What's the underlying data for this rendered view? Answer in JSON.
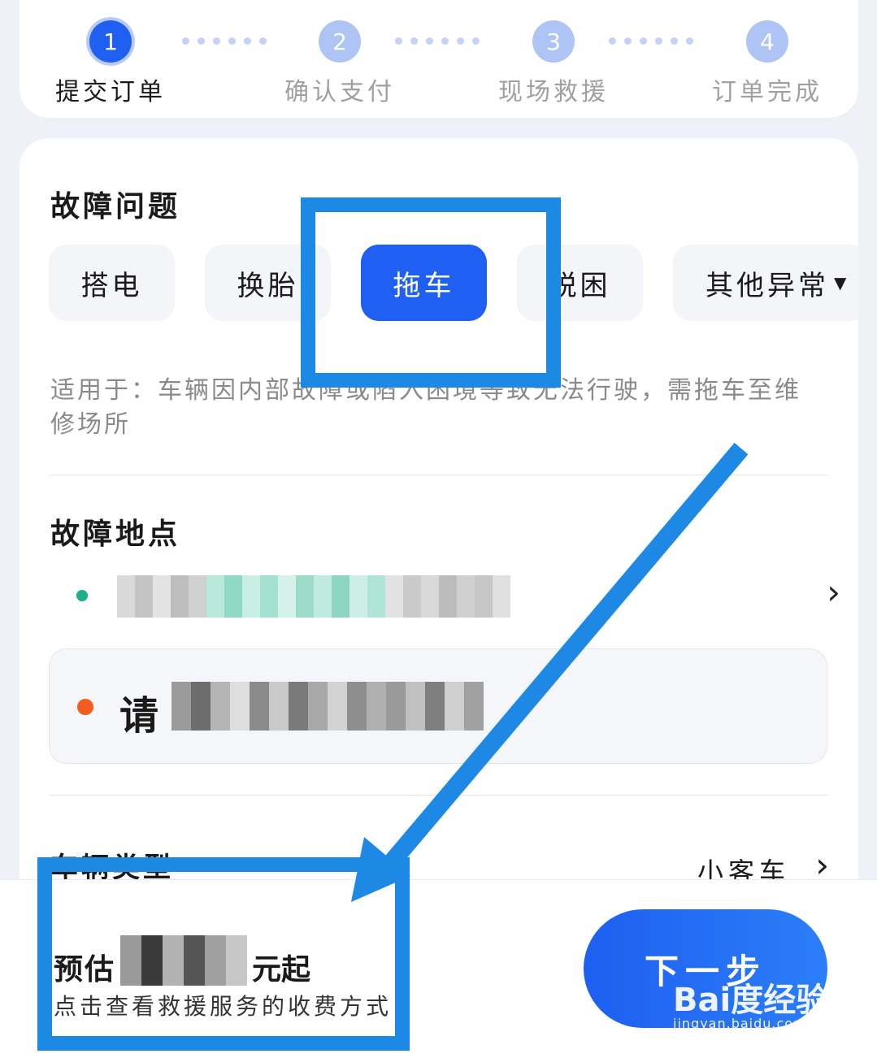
{
  "stepper": {
    "steps": [
      {
        "number": "1",
        "label": "提交订单"
      },
      {
        "number": "2",
        "label": "确认支付"
      },
      {
        "number": "3",
        "label": "现场救援"
      },
      {
        "number": "4",
        "label": "订单完成"
      }
    ]
  },
  "fault": {
    "title": "故障问题",
    "chips": [
      "搭电",
      "换胎",
      "拖车",
      "脱困",
      "其他异常"
    ],
    "selected": "拖车",
    "applicable_text": "适用于：车辆因内部故障或陷入困境等致无法行驶，需拖车至维修场所"
  },
  "location": {
    "title": "故障地点",
    "destination_prefix": "请"
  },
  "vehicle": {
    "label": "车辆类型",
    "value": "小客车"
  },
  "bottom": {
    "price_prefix": "预估",
    "price_suffix": "元起",
    "fee_link": "点击查看救援服务的收费方式",
    "next_button": "下一步"
  },
  "watermark": {
    "logo": "Bai度经验",
    "url": "jingyan.baidu.com"
  },
  "colors": {
    "primary": "#1f5ff2",
    "annotation": "#1e88e5",
    "destination_dot": "#f25c1e",
    "location_pin": "#19b08a"
  },
  "icons": [
    "chevron-right-icon",
    "caret-down-icon",
    "location-pin-icon"
  ]
}
